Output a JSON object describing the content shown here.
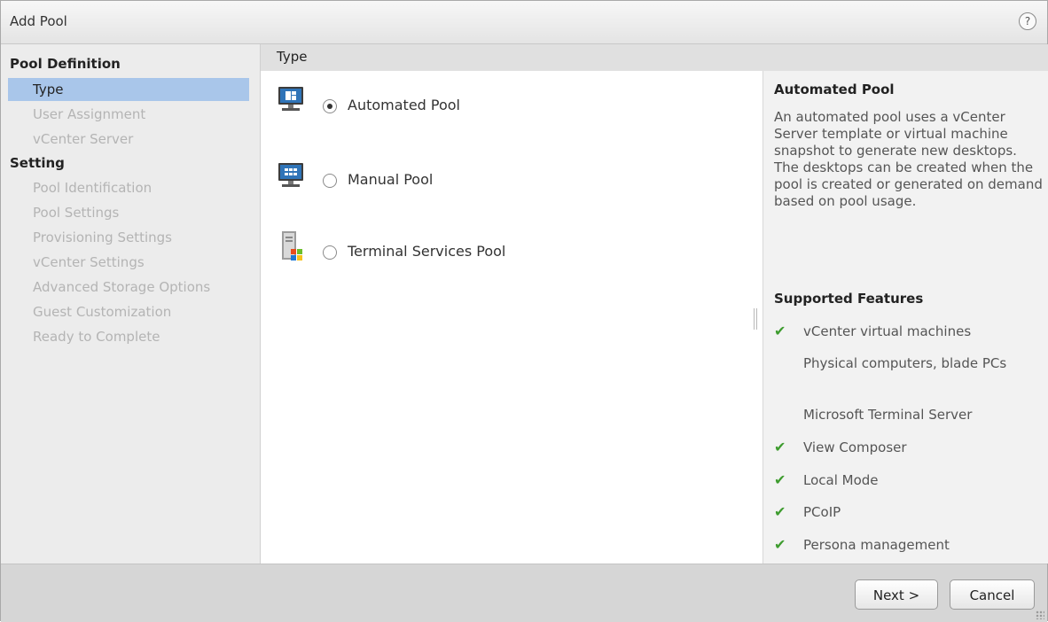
{
  "dialog": {
    "title": "Add Pool",
    "help_label": "?"
  },
  "sidebar": {
    "sections": [
      {
        "label": "Pool Definition",
        "items": [
          "Type",
          "User Assignment",
          "vCenter Server"
        ]
      },
      {
        "label": "Setting",
        "items": [
          "Pool Identification",
          "Pool Settings",
          "Provisioning Settings",
          "vCenter Settings",
          "Advanced Storage Options",
          "Guest Customization",
          "Ready to Complete"
        ]
      }
    ],
    "active_item": "Type"
  },
  "main": {
    "header": "Type",
    "options": [
      {
        "label": "Automated Pool",
        "checked": true,
        "icon": "automated-pool-icon"
      },
      {
        "label": "Manual Pool",
        "checked": false,
        "icon": "manual-pool-icon"
      },
      {
        "label": "Terminal Services Pool",
        "checked": false,
        "icon": "terminal-services-icon"
      }
    ]
  },
  "info": {
    "title": "Automated Pool",
    "description": "An automated pool uses a vCenter Server template or virtual machine snapshot to generate new desktops. The desktops can be created when the pool is created or generated on demand based on pool usage.",
    "features_title": "Supported Features",
    "features": [
      {
        "label": "vCenter virtual machines",
        "supported": true
      },
      {
        "label": "Physical computers, blade PCs",
        "supported": false
      },
      {
        "label": "Microsoft Terminal Server",
        "supported": false
      },
      {
        "label": "View Composer",
        "supported": true
      },
      {
        "label": "Local Mode",
        "supported": true
      },
      {
        "label": "PCoIP",
        "supported": true
      },
      {
        "label": "Persona management",
        "supported": true
      }
    ],
    "check_color": "#3e9c2f"
  },
  "footer": {
    "next_label": "Next >",
    "cancel_label": "Cancel"
  }
}
